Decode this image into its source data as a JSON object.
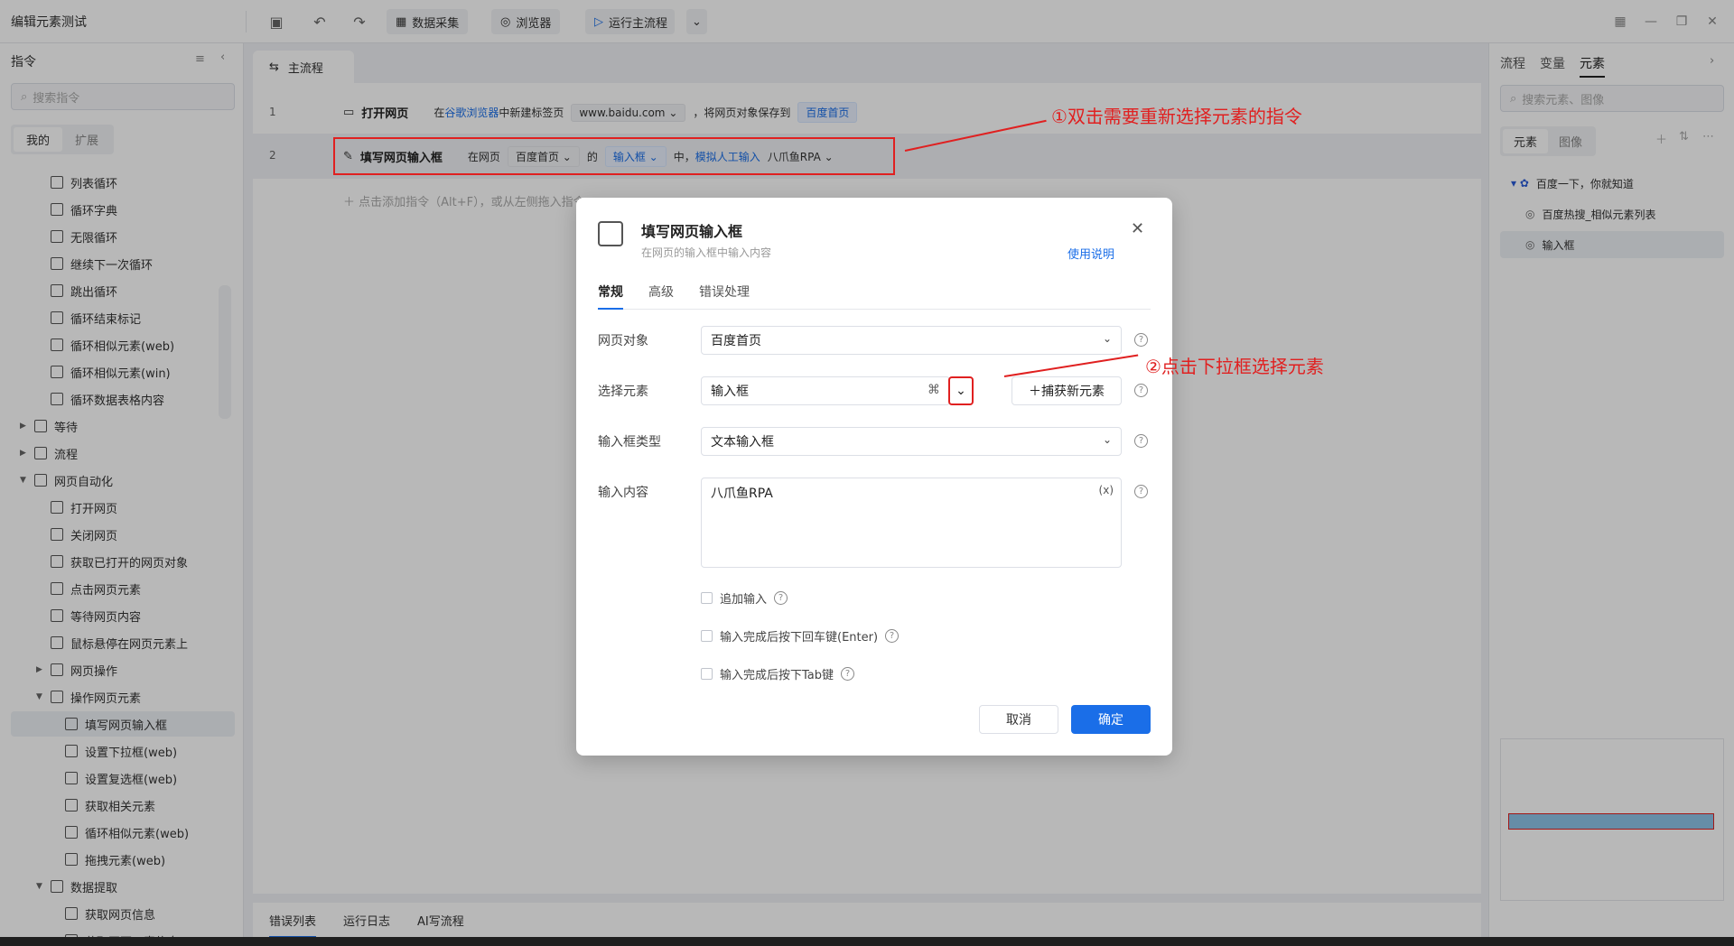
{
  "app": {
    "title": "编辑元素测试"
  },
  "toolbar": {
    "data_capture": "数据采集",
    "browser": "浏览器",
    "run_main": "运行主流程"
  },
  "left_panel": {
    "title": "指令",
    "search_placeholder": "搜索指令",
    "tabs": [
      "我的",
      "扩展"
    ],
    "items": [
      {
        "label": "列表循环",
        "level": 2
      },
      {
        "label": "循环字典",
        "level": 2
      },
      {
        "label": "无限循环",
        "level": 2
      },
      {
        "label": "继续下一次循环",
        "level": 2
      },
      {
        "label": "跳出循环",
        "level": 2
      },
      {
        "label": "循环结束标记",
        "level": 2
      },
      {
        "label": "循环相似元素(web)",
        "level": 2
      },
      {
        "label": "循环相似元素(win)",
        "level": 2
      },
      {
        "label": "循环数据表格内容",
        "level": 2
      },
      {
        "label": "等待",
        "level": 1,
        "arrow": "▶"
      },
      {
        "label": "流程",
        "level": 1,
        "arrow": "▶"
      },
      {
        "label": "网页自动化",
        "level": 1,
        "arrow": "▼"
      },
      {
        "label": "打开网页",
        "level": 2
      },
      {
        "label": "关闭网页",
        "level": 2
      },
      {
        "label": "获取已打开的网页对象",
        "level": 2
      },
      {
        "label": "点击网页元素",
        "level": 2
      },
      {
        "label": "等待网页内容",
        "level": 2
      },
      {
        "label": "鼠标悬停在网页元素上",
        "level": 2
      },
      {
        "label": "网页操作",
        "level": 2,
        "arrow": "▶"
      },
      {
        "label": "操作网页元素",
        "level": 2,
        "arrow": "▼"
      },
      {
        "label": "填写网页输入框",
        "level": 3,
        "selected": true
      },
      {
        "label": "设置下拉框(web)",
        "level": 3
      },
      {
        "label": "设置复选框(web)",
        "level": 3
      },
      {
        "label": "获取相关元素",
        "level": 3
      },
      {
        "label": "循环相似元素(web)",
        "level": 3
      },
      {
        "label": "拖拽元素(web)",
        "level": 3
      },
      {
        "label": "数据提取",
        "level": 2,
        "arrow": "▼"
      },
      {
        "label": "获取网页信息",
        "level": 3
      },
      {
        "label": "获取网页元素信息",
        "level": 3
      }
    ]
  },
  "flow": {
    "tab": "主流程",
    "rows": [
      {
        "num": "1",
        "name": "打开网页",
        "p1": "在",
        "link": "谷歌浏览器",
        "p2": "中新建标签页",
        "chip": "www.baidu.com",
        "p3": "，将网页对象保存到",
        "var": "百度首页"
      },
      {
        "num": "2",
        "name": "填写网页输入框",
        "p1": "在网页",
        "chip1": "百度首页",
        "p2": "的",
        "chip2": "输入框",
        "p3": "中，",
        "mode": "模拟人工输入",
        "value": "八爪鱼RPA"
      }
    ],
    "add_hint": "点击添加指令（Alt+F），或从左侧拖入指令"
  },
  "annotations": {
    "a1": "①双击需要重新选择元素的指令",
    "a2": "②点击下拉框选择元素"
  },
  "bottom_tabs": [
    "错误列表",
    "运行日志",
    "AI写流程"
  ],
  "right_panel": {
    "tabs": [
      "流程",
      "变量",
      "元素"
    ],
    "search_placeholder": "搜索元素、图像",
    "seg": [
      "元素",
      "图像"
    ],
    "elements": [
      {
        "label": "百度一下，你就知道",
        "level": 1
      },
      {
        "label": "百度热搜_相似元素列表",
        "level": 2
      },
      {
        "label": "输入框",
        "level": 2,
        "selected": true
      }
    ]
  },
  "modal": {
    "title": "填写网页输入框",
    "subtitle": "在网页的输入框中输入内容",
    "help": "使用说明",
    "tabs": [
      "常规",
      "高级",
      "错误处理"
    ],
    "fields": {
      "page_object": {
        "label": "网页对象",
        "value": "百度首页"
      },
      "element": {
        "label": "选择元素",
        "value": "输入框",
        "capture": "捕获新元素"
      },
      "input_type": {
        "label": "输入框类型",
        "value": "文本输入框"
      },
      "content": {
        "label": "输入内容",
        "value": "八爪鱼RPA",
        "var_btn": "(x)"
      }
    },
    "checks": [
      "追加输入",
      "输入完成后按下回车键(Enter)",
      "输入完成后按下Tab键"
    ],
    "cancel": "取消",
    "ok": "确定"
  },
  "colors": {
    "accent": "#1a6ee8",
    "annotation": "#e02020"
  }
}
